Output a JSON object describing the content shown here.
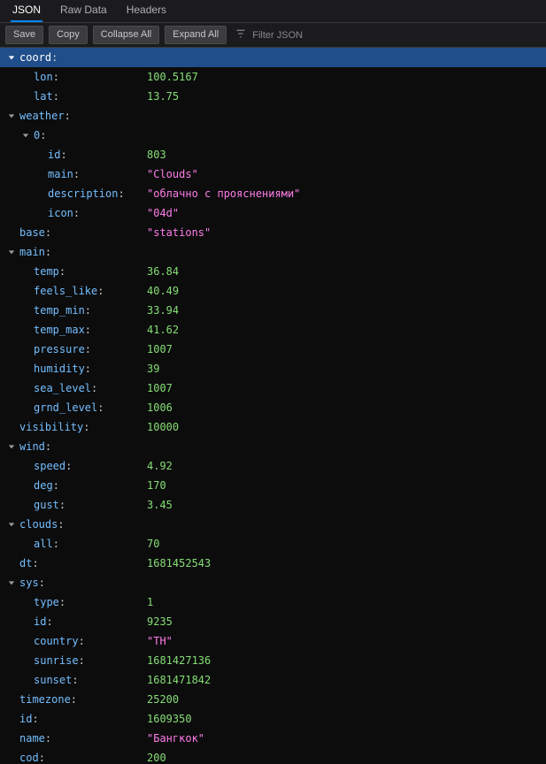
{
  "tabs": {
    "json": "JSON",
    "rawData": "Raw Data",
    "headers": "Headers"
  },
  "toolbar": {
    "save": "Save",
    "copy": "Copy",
    "collapseAll": "Collapse All",
    "expandAll": "Expand All",
    "filterPlaceholder": "Filter JSON"
  },
  "json_content": {
    "coord": {
      "lon": 100.5167,
      "lat": 13.75
    },
    "weather": [
      {
        "id": 803,
        "main": "Clouds",
        "description": "облачно с прояснениями",
        "icon": "04d"
      }
    ],
    "base": "stations",
    "main": {
      "temp": 36.84,
      "feels_like": 40.49,
      "temp_min": 33.94,
      "temp_max": 41.62,
      "pressure": 1007,
      "humidity": 39,
      "sea_level": 1007,
      "grnd_level": 1006
    },
    "visibility": 10000,
    "wind": {
      "speed": 4.92,
      "deg": 170,
      "gust": 3.45
    },
    "clouds": {
      "all": 70
    },
    "dt": 1681452543,
    "sys": {
      "type": 1,
      "id": 9235,
      "country": "TH",
      "sunrise": 1681427136,
      "sunset": 1681471842
    },
    "timezone": 25200,
    "id": 1609350,
    "name": "Бангкок",
    "cod": 200
  },
  "rows": [
    {
      "indent": 0,
      "key": "coord",
      "expanded": true,
      "selected": true,
      "kind": "obj"
    },
    {
      "indent": 1,
      "key": "lon",
      "value": "100.5167",
      "vtype": "num"
    },
    {
      "indent": 1,
      "key": "lat",
      "value": "13.75",
      "vtype": "num"
    },
    {
      "indent": 0,
      "key": "weather",
      "expanded": true,
      "kind": "obj"
    },
    {
      "indent": 1,
      "key": "0",
      "expanded": true,
      "kind": "obj"
    },
    {
      "indent": 2,
      "key": "id",
      "value": "803",
      "vtype": "num"
    },
    {
      "indent": 2,
      "key": "main",
      "value": "\"Clouds\"",
      "vtype": "str"
    },
    {
      "indent": 2,
      "key": "description",
      "value": "\"облачно с прояснениями\"",
      "vtype": "str"
    },
    {
      "indent": 2,
      "key": "icon",
      "value": "\"04d\"",
      "vtype": "str"
    },
    {
      "indent": 0,
      "key": "base",
      "value": "\"stations\"",
      "vtype": "str"
    },
    {
      "indent": 0,
      "key": "main",
      "expanded": true,
      "kind": "obj"
    },
    {
      "indent": 1,
      "key": "temp",
      "value": "36.84",
      "vtype": "num"
    },
    {
      "indent": 1,
      "key": "feels_like",
      "value": "40.49",
      "vtype": "num"
    },
    {
      "indent": 1,
      "key": "temp_min",
      "value": "33.94",
      "vtype": "num"
    },
    {
      "indent": 1,
      "key": "temp_max",
      "value": "41.62",
      "vtype": "num"
    },
    {
      "indent": 1,
      "key": "pressure",
      "value": "1007",
      "vtype": "num"
    },
    {
      "indent": 1,
      "key": "humidity",
      "value": "39",
      "vtype": "num"
    },
    {
      "indent": 1,
      "key": "sea_level",
      "value": "1007",
      "vtype": "num"
    },
    {
      "indent": 1,
      "key": "grnd_level",
      "value": "1006",
      "vtype": "num"
    },
    {
      "indent": 0,
      "key": "visibility",
      "value": "10000",
      "vtype": "num"
    },
    {
      "indent": 0,
      "key": "wind",
      "expanded": true,
      "kind": "obj"
    },
    {
      "indent": 1,
      "key": "speed",
      "value": "4.92",
      "vtype": "num"
    },
    {
      "indent": 1,
      "key": "deg",
      "value": "170",
      "vtype": "num"
    },
    {
      "indent": 1,
      "key": "gust",
      "value": "3.45",
      "vtype": "num"
    },
    {
      "indent": 0,
      "key": "clouds",
      "expanded": true,
      "kind": "obj"
    },
    {
      "indent": 1,
      "key": "all",
      "value": "70",
      "vtype": "num"
    },
    {
      "indent": 0,
      "key": "dt",
      "value": "1681452543",
      "vtype": "num"
    },
    {
      "indent": 0,
      "key": "sys",
      "expanded": true,
      "kind": "obj"
    },
    {
      "indent": 1,
      "key": "type",
      "value": "1",
      "vtype": "num"
    },
    {
      "indent": 1,
      "key": "id",
      "value": "9235",
      "vtype": "num"
    },
    {
      "indent": 1,
      "key": "country",
      "value": "\"TH\"",
      "vtype": "str"
    },
    {
      "indent": 1,
      "key": "sunrise",
      "value": "1681427136",
      "vtype": "num"
    },
    {
      "indent": 1,
      "key": "sunset",
      "value": "1681471842",
      "vtype": "num"
    },
    {
      "indent": 0,
      "key": "timezone",
      "value": "25200",
      "vtype": "num"
    },
    {
      "indent": 0,
      "key": "id",
      "value": "1609350",
      "vtype": "num"
    },
    {
      "indent": 0,
      "key": "name",
      "value": "\"Бангкок\"",
      "vtype": "str"
    },
    {
      "indent": 0,
      "key": "cod",
      "value": "200",
      "vtype": "num"
    }
  ]
}
